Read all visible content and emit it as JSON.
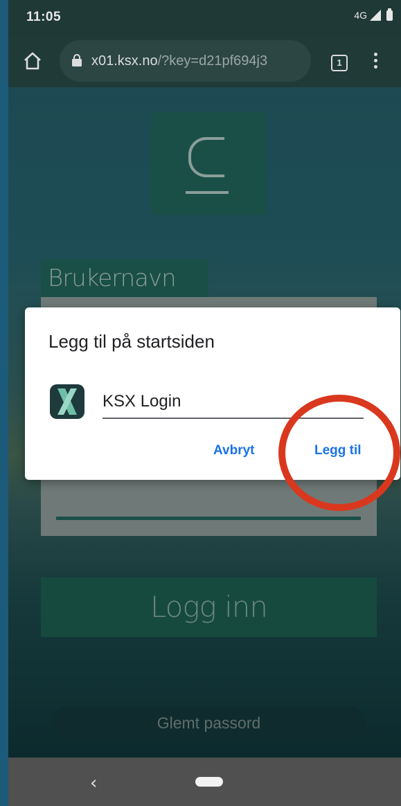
{
  "status_bar": {
    "time": "11:05",
    "network": "4G"
  },
  "browser": {
    "url_domain": "x01.ksx.no",
    "url_path": "/?key=d21pf694j3",
    "tab_count": "1"
  },
  "login_page": {
    "username_label": "Brukernavn",
    "login_button": "Logg inn",
    "forgot_password": "Glemt passord"
  },
  "dialog": {
    "title": "Legg til på startsiden",
    "app_name": "KSX Login",
    "cancel_label": "Avbryt",
    "add_label": "Legg til"
  },
  "colors": {
    "accent": "#1a73e8",
    "highlight": "#d9381e",
    "brand": "#1a4f47"
  },
  "icons": {
    "home": "home-icon",
    "lock": "lock-icon",
    "menu": "more-vert-icon",
    "back": "back-icon",
    "app": "ksx-app-icon"
  }
}
